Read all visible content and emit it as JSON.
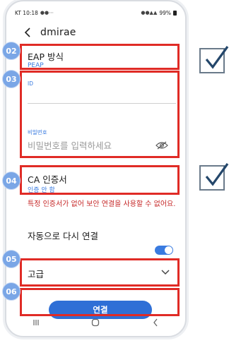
{
  "statusbar": {
    "carrier_time": "KT 10:18",
    "battery": "99%"
  },
  "header": {
    "title": "dmirae"
  },
  "eap": {
    "label": "EAP 방식",
    "value": "PEAP"
  },
  "id_field": {
    "label": "ID",
    "value": ""
  },
  "password_field": {
    "label": "비밀번호",
    "placeholder": "비밀번호를 입력하세요"
  },
  "ca": {
    "label": "CA 인증서",
    "value": "인증 안 함",
    "warning": "특정 인증서가 없어 보안 연결을 사용할 수 없어요."
  },
  "auto_reconnect": {
    "label": "자동으로 다시 연결",
    "enabled": true
  },
  "advanced": {
    "label": "고급"
  },
  "connect_button": {
    "label": "연결"
  },
  "callouts": [
    {
      "badge": "02"
    },
    {
      "badge": "03"
    },
    {
      "badge": "04"
    },
    {
      "badge": "05"
    },
    {
      "badge": "06"
    }
  ],
  "colors": {
    "callout_red": "#e02b26",
    "badge_blue": "#7aa6e6",
    "accent_blue": "#3a7be0",
    "button_blue": "#2f6fd6",
    "warning_red": "#c62828"
  }
}
